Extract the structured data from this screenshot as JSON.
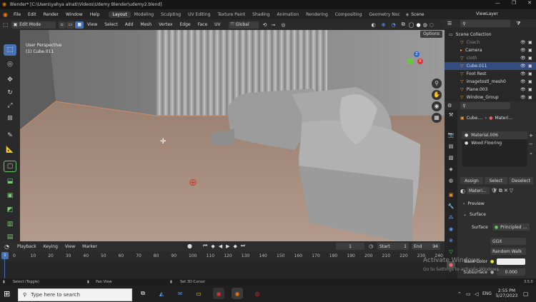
{
  "titlebar": {
    "title": "Blender* [C:\\Users\\yahya alnati\\Videos\\Udemy Blender\\udemy2.blend]",
    "minimize": "—",
    "maximize": "❐",
    "close": "✕"
  },
  "menubar": {
    "menus": [
      "File",
      "Edit",
      "Render",
      "Window",
      "Help"
    ],
    "workspaces": [
      "Layout",
      "Modeling",
      "Sculpting",
      "UV Editing",
      "Texture Paint",
      "Shading",
      "Animation",
      "Rendering",
      "Compositing",
      "Geometry Noc"
    ],
    "scene_label": "Scene",
    "viewlayer_label": "ViewLayer"
  },
  "viewport_header": {
    "mode": "Edit Mode",
    "menus": [
      "View",
      "Select",
      "Add",
      "Mesh",
      "Vertex",
      "Edge",
      "Face",
      "UV"
    ],
    "orientation": "Global",
    "options": "Options"
  },
  "viewport": {
    "perspective": "User Perspective",
    "object_name": "(1) Cube.011",
    "gizmo_axes": {
      "x": "X",
      "y": "Y",
      "z": "Z"
    }
  },
  "outliner": {
    "collection": "Scene Collection",
    "items": [
      {
        "name": "Coach",
        "icon": "triangle-icon",
        "dim": true
      },
      {
        "name": "Camera",
        "icon": "camera-icon",
        "dim": false
      },
      {
        "name": "cloth",
        "icon": "triangle-icon",
        "dim": true
      },
      {
        "name": "Cube.011",
        "icon": "mesh-icon",
        "dim": false,
        "selected": true
      },
      {
        "name": "Foot Rest",
        "icon": "triangle-icon",
        "dim": false
      },
      {
        "name": "imagetostl_mesh0",
        "icon": "triangle-icon",
        "dim": false
      },
      {
        "name": "Plane.003",
        "icon": "triangle-icon",
        "dim": false
      },
      {
        "name": "Window_Group",
        "icon": "triangle-icon",
        "dim": false
      }
    ]
  },
  "properties": {
    "object_crumb": "Cube....",
    "material_crumb": "Materi...",
    "slots": [
      "Material.006",
      "Wood Flooring"
    ],
    "assign": "Assign",
    "select": "Select",
    "deselect": "Deselect",
    "material_field": "Materi...",
    "preview": "Preview",
    "surface_section": "Surface",
    "surface_label": "Surface",
    "surface_value": "Principled ...",
    "distribution": "GGX",
    "subsurface_method": "Random Walk",
    "base_color_label": "Base Color",
    "subsurface_label": "Subsurface",
    "subsurface_value": "0.000"
  },
  "timeline": {
    "menus": [
      "Playback",
      "Keying",
      "View",
      "Marker"
    ],
    "current_frame": "1",
    "start_label": "Start",
    "start": "1",
    "end_label": "End",
    "end": "94",
    "ticks": [
      "0",
      "10",
      "20",
      "30",
      "40",
      "50",
      "60",
      "70",
      "80",
      "90",
      "100",
      "110",
      "120",
      "130",
      "140",
      "150",
      "160",
      "170",
      "180",
      "190",
      "200",
      "210",
      "220",
      "230",
      "240",
      "250"
    ]
  },
  "statusbar": {
    "left": "Select (Toggle)",
    "mid": "Pan View",
    "right": "Set 3D Cursor",
    "version": "3.5.0"
  },
  "watermark": {
    "line1": "Activate Windows",
    "line2": "Go to Settings to activate Windows."
  },
  "taskbar": {
    "search_placeholder": "Type here to search",
    "lang": "ENG",
    "time": "2:55 PM",
    "date": "5/27/2023"
  }
}
